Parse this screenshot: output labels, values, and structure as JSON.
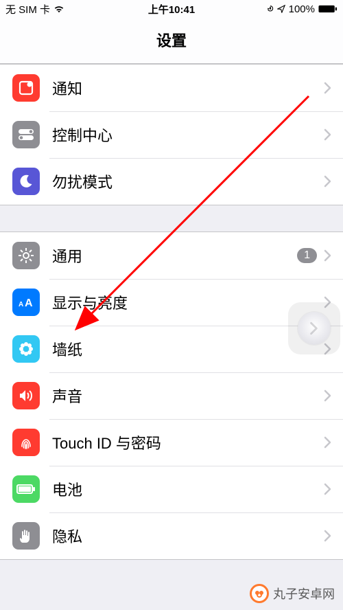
{
  "status": {
    "carrier": "无 SIM 卡",
    "time": "上午10:41",
    "battery_pct": "100%"
  },
  "page_title": "设置",
  "groups": [
    {
      "rows": [
        {
          "id": "notifications",
          "label": "通知",
          "icon": "notifications-icon",
          "iconClass": "ic-red"
        },
        {
          "id": "control-center",
          "label": "控制中心",
          "icon": "toggles-icon",
          "iconClass": "ic-grey"
        },
        {
          "id": "dnd",
          "label": "勿扰模式",
          "icon": "moon-icon",
          "iconClass": "ic-purple"
        }
      ]
    },
    {
      "rows": [
        {
          "id": "general",
          "label": "通用",
          "icon": "gear-icon",
          "iconClass": "ic-gear",
          "badge": "1"
        },
        {
          "id": "display",
          "label": "显示与亮度",
          "icon": "text-size-icon",
          "iconClass": "ic-blue"
        },
        {
          "id": "wallpaper",
          "label": "墙纸",
          "icon": "flower-icon",
          "iconClass": "ic-cyan"
        },
        {
          "id": "sound",
          "label": "声音",
          "icon": "speaker-icon",
          "iconClass": "ic-red"
        },
        {
          "id": "touchid",
          "label": "Touch ID 与密码",
          "icon": "fingerprint-icon",
          "iconClass": "ic-red"
        },
        {
          "id": "battery",
          "label": "电池",
          "icon": "battery-icon",
          "iconClass": "ic-green"
        },
        {
          "id": "privacy",
          "label": "隐私",
          "icon": "hand-icon",
          "iconClass": "ic-grey"
        }
      ]
    }
  ],
  "annotation": {
    "arrow_target": "display"
  },
  "watermark": "丸子安卓网"
}
